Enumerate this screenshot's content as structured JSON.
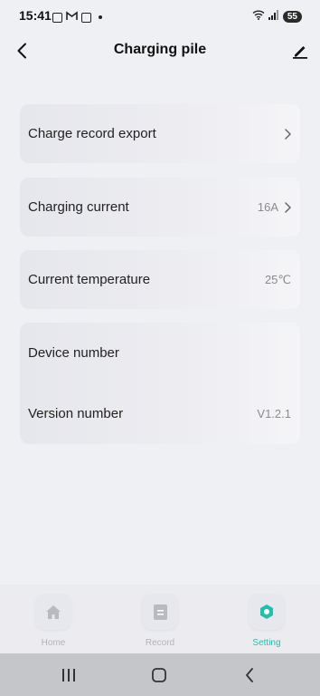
{
  "status": {
    "time": "15:41",
    "battery": "55"
  },
  "header": {
    "title": "Charging pile"
  },
  "settings": {
    "charge_record_export": {
      "label": "Charge record export"
    },
    "charging_current": {
      "label": "Charging current",
      "value": "16A"
    },
    "current_temperature": {
      "label": "Current temperature",
      "value": "25℃"
    },
    "device_number": {
      "label": "Device number"
    },
    "version_number": {
      "label": "Version number",
      "value": "V1.2.1"
    }
  },
  "tabs": [
    {
      "label": "Home",
      "icon": "home-icon"
    },
    {
      "label": "Record",
      "icon": "record-icon"
    },
    {
      "label": "Setting",
      "icon": "setting-icon",
      "active": true
    }
  ],
  "colors": {
    "accent": "#22bfad",
    "background": "#eff0f4",
    "card": "#e9eaef"
  }
}
